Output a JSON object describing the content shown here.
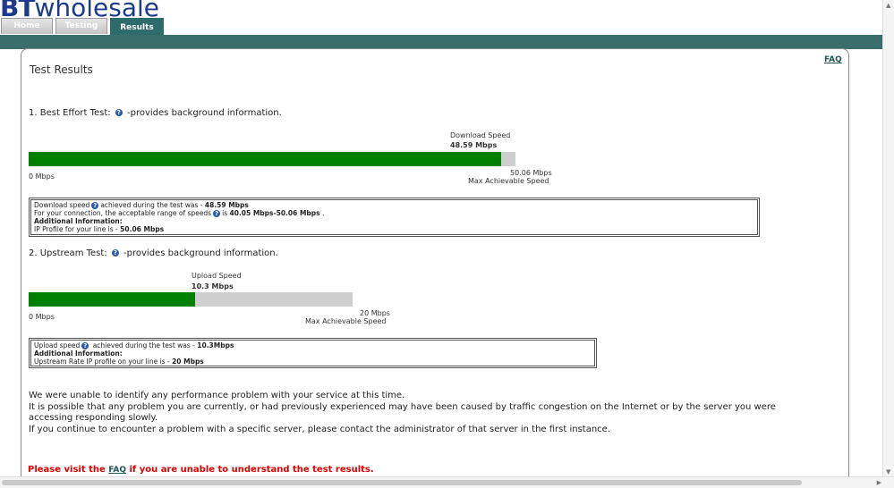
{
  "brand": {
    "bt": "BT",
    "wholesale": "wholesale"
  },
  "tabs": [
    {
      "label": "Home"
    },
    {
      "label": "Testing"
    },
    {
      "label": "Results"
    }
  ],
  "faq": "FAQ",
  "title": "Test Results",
  "best_effort": {
    "heading": "1. Best Effort Test:",
    "heading_suffix": "-provides background information.",
    "speed_label": "Download Speed",
    "speed_value": "48.59 Mbps",
    "min_label": "0 Mbps",
    "max_value": "50.06 Mbps",
    "max_label": "Max Achievable Speed",
    "fill_fraction": 0.9706,
    "info": {
      "line1_pre": "Download speed",
      "line1_mid": "achieved during the test was - ",
      "line1_val": "48.59 Mbps",
      "line2_pre": "For your connection, the acceptable range of speeds",
      "line2_mid": "is ",
      "line2_val": "40.05 Mbps-50.06 Mbps",
      "line2_end": " .",
      "line3": "Additional Information:",
      "line4_pre": "IP Profile for your line is - ",
      "line4_val": "50.06 Mbps"
    }
  },
  "upstream": {
    "heading": "2. Upstream Test:",
    "heading_suffix": "-provides background information.",
    "speed_label": "Upload Speed",
    "speed_value": "10.3 Mbps",
    "min_label": "0 Mbps",
    "max_value": "20 Mbps",
    "max_label": "Max Achievable Speed",
    "fill_fraction": 0.515,
    "info": {
      "line1_pre": "Upload speed",
      "line1_mid": " achieved during the test was - ",
      "line1_val": "10.3Mbps",
      "line2": "Additional Information:",
      "line3_pre": "Upstream Rate IP profile on your line is - ",
      "line3_val": "20 Mbps"
    }
  },
  "message": {
    "line1": "We were unable to identify any performance problem with your service at this time.",
    "line2": "It is possible that any problem you are currently, or had previously experienced may have been caused by traffic congestion on the Internet or by the server you were accessing responding slowly.",
    "line3": "If you continue to encounter a problem with a specific server, please contact the administrator of that server in the first instance."
  },
  "final": {
    "pre": "Please visit the ",
    "link": "FAQ",
    "post": " if you are unable to understand the test results."
  },
  "colors": {
    "bar_fill": "#008000",
    "bar_track": "#cfcfcf",
    "header_bar": "#3a6e6c",
    "alert": "#e00000"
  }
}
